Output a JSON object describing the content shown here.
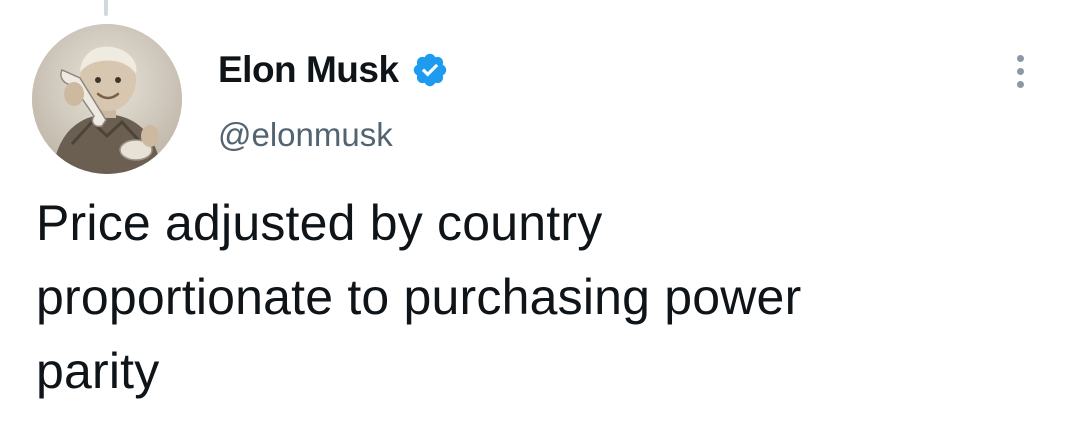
{
  "tweet": {
    "author": {
      "display_name": "Elon Musk",
      "handle": "@elonmusk",
      "verified_icon": "verified-badge-icon",
      "avatar": "child-with-telephone-photo"
    },
    "text_lines": [
      "Price adjusted by country",
      "proportionate to purchasing power",
      "parity"
    ],
    "more_icon": "more-options-icon"
  },
  "colors": {
    "verified": "#1d9bf0",
    "handle": "#536471",
    "text": "#0f1419"
  }
}
